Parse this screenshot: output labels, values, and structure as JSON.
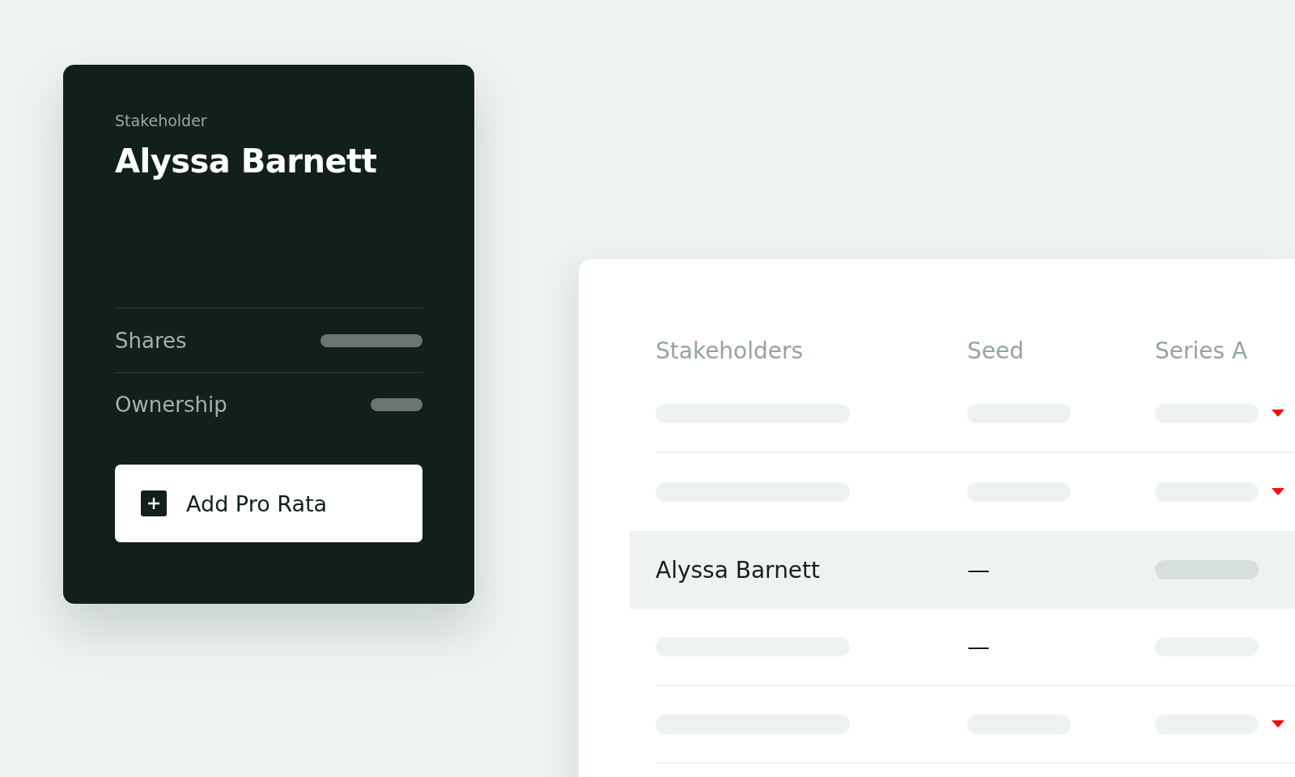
{
  "stakeholder_card": {
    "label": "Stakeholder",
    "name": "Alyssa Barnett",
    "fields": [
      {
        "label": "Shares"
      },
      {
        "label": "Ownership"
      }
    ],
    "button": {
      "label": "Add Pro Rata"
    }
  },
  "table": {
    "columns": [
      "Stakeholders",
      "Seed",
      "Series A"
    ],
    "rows": [
      {
        "name": null,
        "seed": null,
        "decreased": true,
        "selected": false
      },
      {
        "name": null,
        "seed": null,
        "decreased": true,
        "selected": false
      },
      {
        "name": "Alyssa Barnett",
        "seed": "—",
        "decreased": false,
        "selected": true
      },
      {
        "name": null,
        "seed": "—",
        "decreased": false,
        "selected": false
      },
      {
        "name": null,
        "seed": null,
        "decreased": true,
        "selected": false
      }
    ]
  }
}
